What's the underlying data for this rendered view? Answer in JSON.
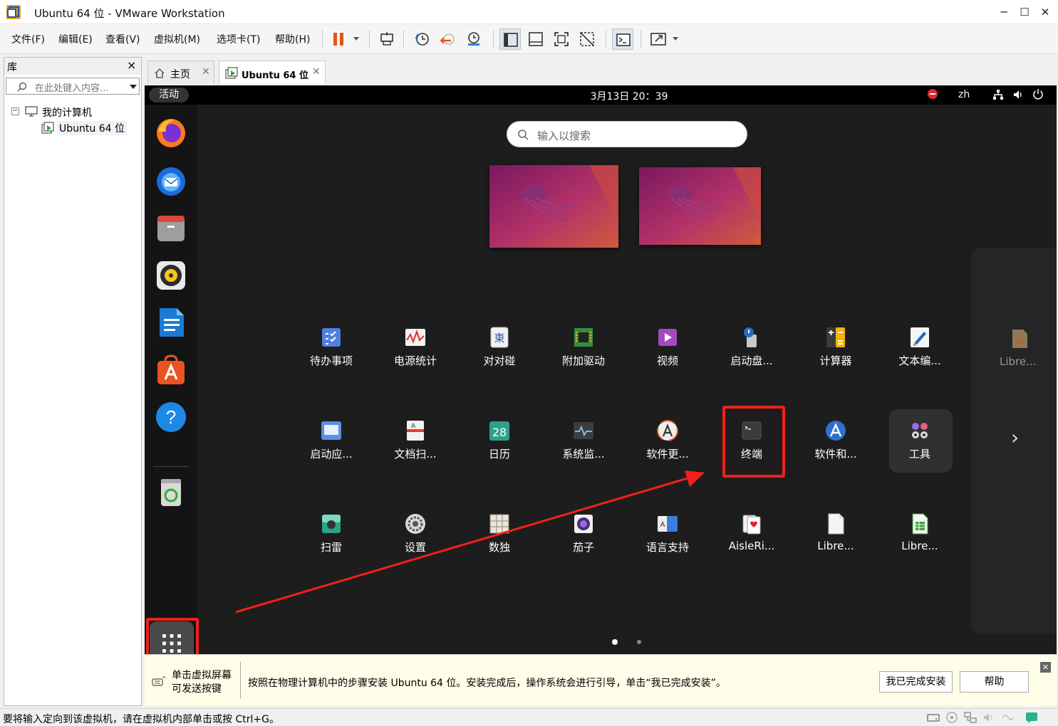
{
  "window": {
    "title": "Ubuntu 64 位 - VMware Workstation",
    "minimize": "─",
    "maximize": "☐",
    "close": "✕"
  },
  "menu": [
    "文件(F)",
    "编辑(E)",
    "查看(V)",
    "虚拟机(M)",
    "选项卡(T)",
    "帮助(H)"
  ],
  "library": {
    "title": "库",
    "close": "×",
    "search_placeholder": "在此处键入内容...",
    "tree": {
      "root": "我的计算机",
      "child": "Ubuntu 64 位"
    }
  },
  "tabs": [
    {
      "label": "主页",
      "close": "✕"
    },
    {
      "label": "Ubuntu 64 位",
      "close": "✕"
    }
  ],
  "ubuntu": {
    "activities": "活动",
    "clock": "3月13日  20：39",
    "lang": "zh",
    "search_placeholder": "输入以搜索",
    "next_arrow": "›",
    "offpage_label": "Libre...",
    "apps_row1": [
      "待办事项",
      "电源统计",
      "对对碰",
      "附加驱动",
      "视频",
      "启动盘...",
      "计算器",
      "文本编..."
    ],
    "apps_row2": [
      "启动应...",
      "文档扫...",
      "日历",
      "系统监...",
      "软件更...",
      "终端",
      "软件和...",
      "工具"
    ],
    "apps_row3": [
      "扫雷",
      "设置",
      "数独",
      "茄子",
      "语言支持",
      "AisleRi...",
      "Libre...",
      "Libre..."
    ],
    "calendar_day": "28",
    "mahjong_char": "東",
    "page_dots": 2
  },
  "hint": {
    "line1": "单击虚拟屏幕",
    "line2": "可发送按键",
    "message": "按照在物理计算机中的步骤安装 Ubuntu 64 位。安装完成后，操作系统会进行引导，单击“我已完成安装”。",
    "done_button": "我已完成安装",
    "help_button": "帮助",
    "close": "✕"
  },
  "status": {
    "text": "要将输入定向到该虚拟机，请在虚拟机内部单击或按 Ctrl+G。"
  },
  "colors": {
    "annotation_red": "#f0201c",
    "ubuntu_bg": "#1d1d1d",
    "accent_orange": "#e95420"
  }
}
